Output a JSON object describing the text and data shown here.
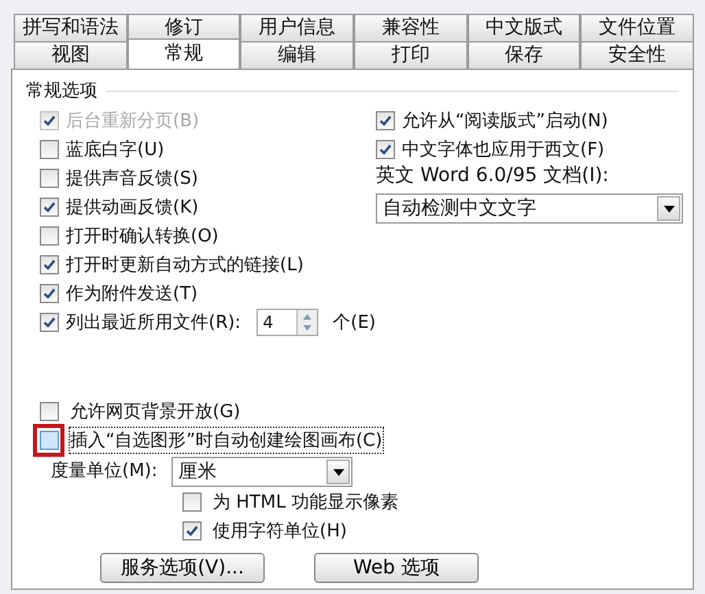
{
  "tabs_row1": [
    {
      "label": "拼写和语法",
      "selected": false
    },
    {
      "label": "修订",
      "selected": false
    },
    {
      "label": "用户信息",
      "selected": false
    },
    {
      "label": "兼容性",
      "selected": false
    },
    {
      "label": "中文版式",
      "selected": false
    },
    {
      "label": "文件位置",
      "selected": false
    }
  ],
  "tabs_row2": [
    {
      "label": "视图",
      "selected": false
    },
    {
      "label": "常规",
      "selected": true
    },
    {
      "label": "编辑",
      "selected": false
    },
    {
      "label": "打印",
      "selected": false
    },
    {
      "label": "保存",
      "selected": false
    },
    {
      "label": "安全性",
      "selected": false
    }
  ],
  "group_title": "常规选项",
  "left_options": [
    {
      "label": "后台重新分页(B)",
      "checked": true,
      "disabled": true
    },
    {
      "label": "蓝底白字(U)",
      "checked": false,
      "disabled": false
    },
    {
      "label": "提供声音反馈(S)",
      "checked": false,
      "disabled": false
    },
    {
      "label": "提供动画反馈(K)",
      "checked": true,
      "disabled": false
    },
    {
      "label": "打开时确认转换(O)",
      "checked": false,
      "disabled": false
    },
    {
      "label": "打开时更新自动方式的链接(L)",
      "checked": true,
      "disabled": false
    },
    {
      "label": "作为附件发送(T)",
      "checked": true,
      "disabled": false
    }
  ],
  "recent_files": {
    "label": "列出最近所用文件(R):",
    "checked": true,
    "value": "4",
    "unit": "个(E)"
  },
  "right_options": [
    {
      "label": "允许从“阅读版式”启动(N)",
      "checked": true
    },
    {
      "label": "中文字体也应用于西文(F)",
      "checked": true
    }
  ],
  "word95": {
    "label": "英文 Word 6.0/95 文档(I):",
    "value": "自动检测中文文字"
  },
  "lower_options": [
    {
      "label": "允许网页背景开放(G)",
      "checked": false,
      "focused": false
    },
    {
      "label": "插入“自选图形”时自动创建绘图画布(C)",
      "checked": false,
      "focused": true
    }
  ],
  "measure": {
    "label": "度量单位(M):",
    "value": "厘米"
  },
  "measure_options": [
    {
      "label": "为 HTML 功能显示像素",
      "checked": false
    },
    {
      "label": "使用字符单位(H)",
      "checked": true
    }
  ],
  "buttons": [
    "服务选项(V)...",
    "Web 选项"
  ]
}
